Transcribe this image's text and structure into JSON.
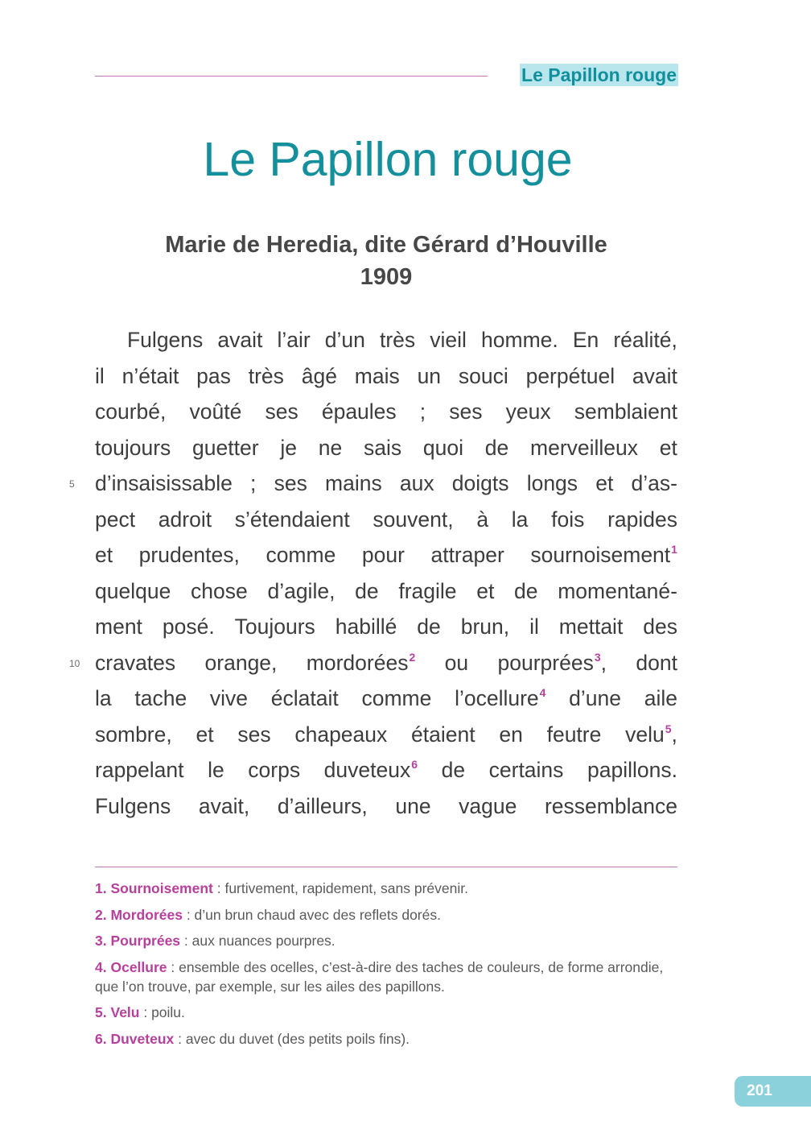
{
  "header": {
    "running_title": "Le Papillon rouge"
  },
  "title": "Le Papillon rouge",
  "author": {
    "name": "Marie de Heredia, dite Gérard d’Houville",
    "year": "1909"
  },
  "text_lines": [
    {
      "words": [
        "Fulgens",
        "avait",
        "l’air",
        "d’un",
        "très",
        "vieil",
        "homme.",
        "En",
        "réalité,"
      ]
    },
    {
      "words": [
        "il",
        "n’était",
        "pas",
        "très",
        "âgé",
        "mais",
        "un",
        "souci",
        "perpétuel",
        "avait"
      ]
    },
    {
      "words": [
        "courbé,",
        "voûté",
        "ses",
        "épaules",
        ";",
        "ses",
        "yeux",
        "semblaient"
      ]
    },
    {
      "words": [
        "toujours",
        "guetter",
        "je",
        "ne",
        "sais",
        "quoi",
        "de",
        "merveilleux",
        "et"
      ]
    },
    {
      "words": [
        "d’insaisissable",
        ";",
        "ses",
        "mains",
        "aux",
        "doigts",
        "longs",
        "et",
        "d’as-"
      ]
    },
    {
      "words": [
        "pect",
        "adroit",
        "s’étendaient",
        "souvent,",
        "à",
        "la",
        "fois",
        "rapides"
      ]
    },
    {
      "words": [
        "et",
        "prudentes,",
        "comme",
        "pour",
        "attraper",
        "sournoisement"
      ]
    },
    {
      "words": [
        "quelque",
        "chose",
        "d’agile,",
        "de",
        "fragile",
        "et",
        "de",
        "momentané-"
      ]
    },
    {
      "words": [
        "ment",
        "posé.",
        "Toujours",
        "habillé",
        "de",
        "brun,",
        "il",
        "mettait",
        "des"
      ]
    },
    {
      "words": [
        "cravates",
        "orange,",
        "mordorées",
        "ou",
        "pourprées",
        ",",
        "dont"
      ]
    },
    {
      "words": [
        "la",
        "tache",
        "vive",
        "éclatait",
        "comme",
        "l’ocellure",
        "d’une",
        "aile"
      ]
    },
    {
      "words": [
        "sombre,",
        "et",
        "ses",
        "chapeaux",
        "étaient",
        "en",
        "feutre",
        "velu",
        ","
      ]
    },
    {
      "words": [
        "rappelant",
        "le",
        "corps",
        "duveteux",
        "de",
        "certains",
        "papillons."
      ]
    },
    {
      "words": [
        "Fulgens",
        "avait,",
        "d’ailleurs,",
        "une",
        "vague",
        "ressemblance"
      ]
    }
  ],
  "footnote_marks": [
    "1",
    "2",
    "3",
    "4",
    "5",
    "6"
  ],
  "line_numbers": [
    "5",
    "10"
  ],
  "footnotes": [
    {
      "num": "1.",
      "term": "Sournoisement",
      "def": " : furtivement, rapidement, sans prévenir."
    },
    {
      "num": "2.",
      "term": "Mordorées",
      "def": " : d’un brun chaud avec des reflets dorés."
    },
    {
      "num": "3.",
      "term": "Pourprées",
      "def": " : aux nuances pourpres."
    },
    {
      "num": "4.",
      "term": "Ocellure",
      "def": " : ensemble des ocelles, c’est-à-dire des taches de couleurs, de forme arrondie, que l’on trouve, par exemple, sur les ailes des papillons."
    },
    {
      "num": "5.",
      "term": "Velu",
      "def": " : poilu."
    },
    {
      "num": "6.",
      "term": "Duveteux",
      "def": " : avec du duvet (des petits poils fins)."
    }
  ],
  "page_number": "201",
  "colors": {
    "accent_teal": "#14909c",
    "accent_magenta": "#b73f9d",
    "highlight": "#b8e6ec",
    "page_tab": "#8bd1dc"
  }
}
